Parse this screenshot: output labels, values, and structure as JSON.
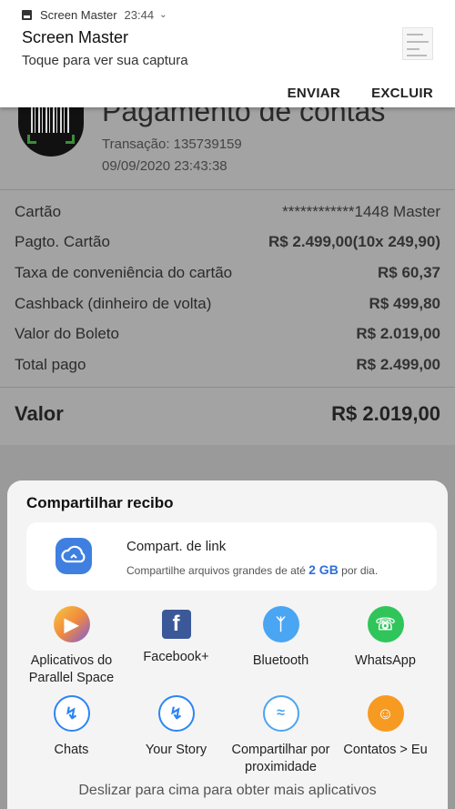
{
  "notification": {
    "app_name": "Screen Master",
    "time": "23:44",
    "title": "Screen Master",
    "text": "Toque para ver sua captura",
    "actions": [
      "ENVIAR",
      "EXCLUIR"
    ]
  },
  "receipt": {
    "title": "Pagamento de contas",
    "transaction": "Transação: 135739159",
    "datetime": "09/09/2020 23:43:38",
    "rows": [
      {
        "label": "Cartão",
        "value": "************1448 Master"
      },
      {
        "label": "Pagto. Cartão",
        "value": "R$ 2.499,00(10x 249,90)"
      },
      {
        "label": "Taxa de conveniência do cartão",
        "value": "R$ 60,37"
      },
      {
        "label": "Cashback (dinheiro de volta)",
        "value": "R$ 499,80"
      },
      {
        "label": "Valor do Boleto",
        "value": "R$ 2.019,00"
      },
      {
        "label": "Total pago",
        "value": "R$ 2.499,00"
      }
    ],
    "total_label": "Valor",
    "total_value": "R$ 2.019,00"
  },
  "share_sheet": {
    "title": "Compartilhar recibo",
    "link_share": {
      "title": "Compart. de link",
      "sub_before": "Compartilhe arquivos grandes de até",
      "sub_size": "2 GB",
      "sub_after": "por dia."
    },
    "apps": [
      {
        "label": "Aplicativos do Parallel Space",
        "icon": "parallel-space-icon"
      },
      {
        "label": "Facebook+",
        "icon": "facebook-icon"
      },
      {
        "label": "Bluetooth",
        "icon": "bluetooth-icon"
      },
      {
        "label": "WhatsApp",
        "icon": "whatsapp-icon"
      },
      {
        "label": "Chats",
        "icon": "messenger-chats-icon"
      },
      {
        "label": "Your Story",
        "icon": "messenger-story-icon"
      },
      {
        "label": "Compartilhar por proximidade",
        "icon": "nearby-share-icon"
      },
      {
        "label": "Contatos > Eu",
        "icon": "contacts-icon"
      }
    ],
    "more_hint": "Deslizar para cima para obter mais aplicativos"
  }
}
